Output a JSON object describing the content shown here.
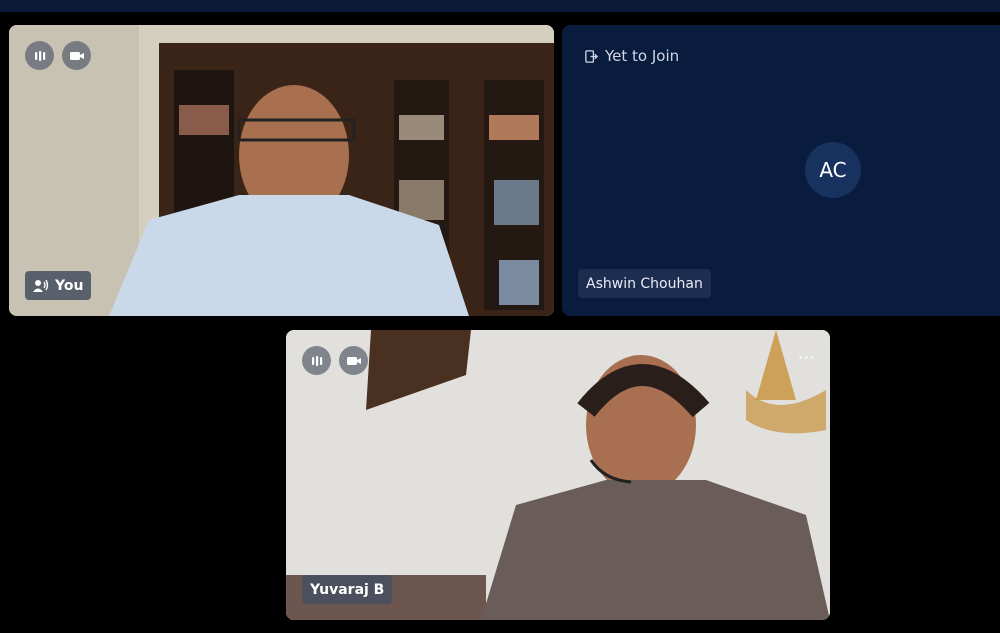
{
  "participants": {
    "you": {
      "name": "You"
    },
    "ashwin": {
      "name": "Ashwin Chouhan",
      "initials": "AC",
      "status": "Yet to Join"
    },
    "yuvaraj": {
      "name": "Yuvaraj B",
      "more": "···"
    }
  },
  "colors": {
    "background": "#000000",
    "topbar": "#0b1a36",
    "waiting_tile": "#0a1c3d",
    "avatar": "#18325f"
  },
  "icons": [
    "audio-level-icon",
    "camera-icon",
    "speaker-icon",
    "exit-door-icon",
    "more-options-icon"
  ]
}
